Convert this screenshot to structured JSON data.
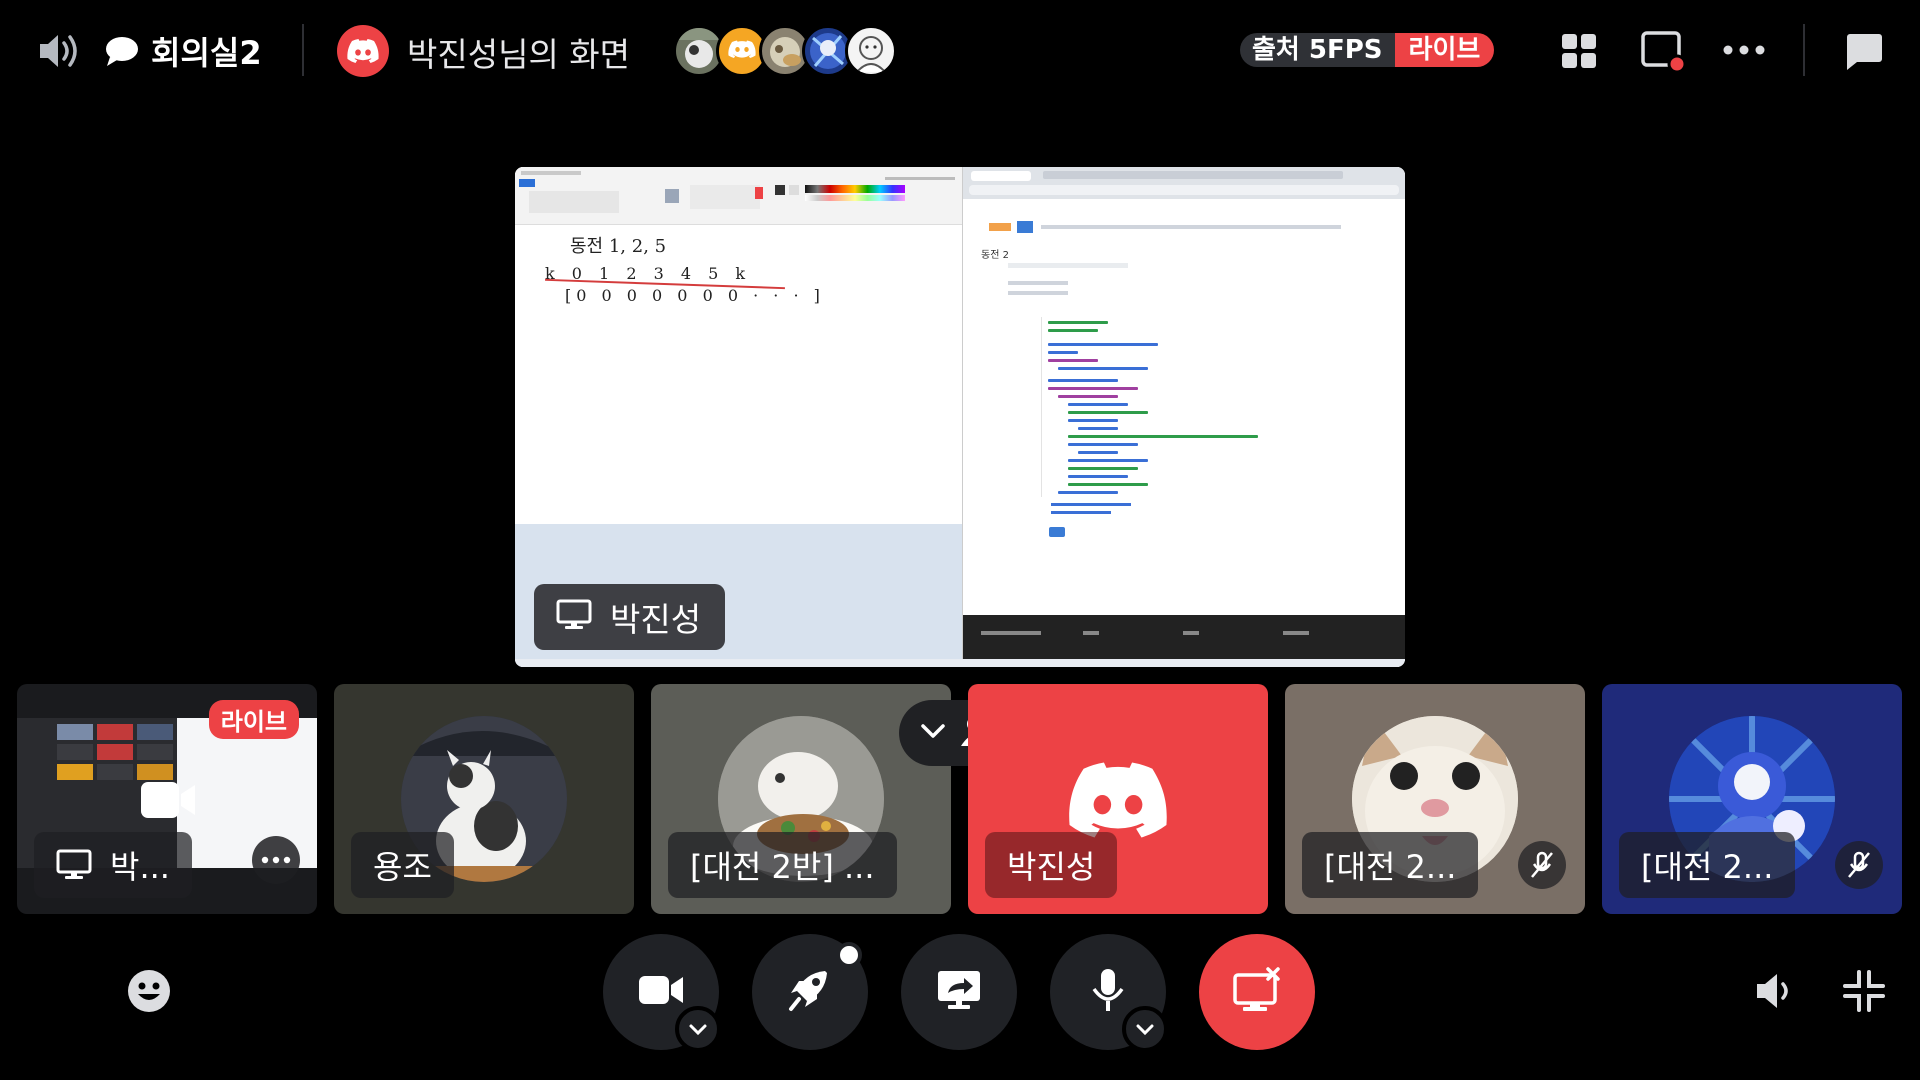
{
  "topbar": {
    "channel_name": "회의실2",
    "stream_title": "박진성님의 화면",
    "stats": {
      "fps": "출처 5FPS",
      "live": "라이브"
    },
    "icons": {
      "voice": "speaker-voice-icon",
      "chat": "chat-bubble-icon",
      "discord": "discord-logo-icon",
      "grid": "grid-layout-icon",
      "popout": "popout-window-icon",
      "more": "more-options-icon",
      "chat_panel": "chat-panel-icon"
    }
  },
  "stage": {
    "presenter_name": "박진성",
    "paint_text_top": "동전   1, 2, 5",
    "paint_text_mid": "k  0  1  2  3  4  5      k",
    "paint_text_bot": "[0  0  0  0  0  0  0  · · · ]",
    "browser_title": "동전 2"
  },
  "tiles": [
    {
      "name": "박...",
      "kind": "screen",
      "live": "라이브",
      "bg": "#1a1b1e"
    },
    {
      "name": "용조",
      "kind": "avatar",
      "bg": "#35362f"
    },
    {
      "name": "[대전 2반] ...",
      "kind": "avatar",
      "bg": "#5c5d57"
    },
    {
      "name": "박진성",
      "kind": "discord",
      "bg": "#ed4245"
    },
    {
      "name": "[대전 2...",
      "kind": "avatar",
      "muted": true,
      "bg": "#7a6f66"
    },
    {
      "name": "[대전 2...",
      "kind": "avatar",
      "muted": true,
      "bg": "#1f2a7a"
    }
  ],
  "controls": {
    "icons": [
      "emoji-icon",
      "camera-icon",
      "activity-rocket-icon",
      "share-screen-icon",
      "microphone-icon",
      "stop-stream-icon",
      "volume-icon",
      "minimize-icon"
    ]
  },
  "colors": {
    "brand_red": "#ed4245",
    "control_bg": "#202226",
    "background": "#000000"
  }
}
